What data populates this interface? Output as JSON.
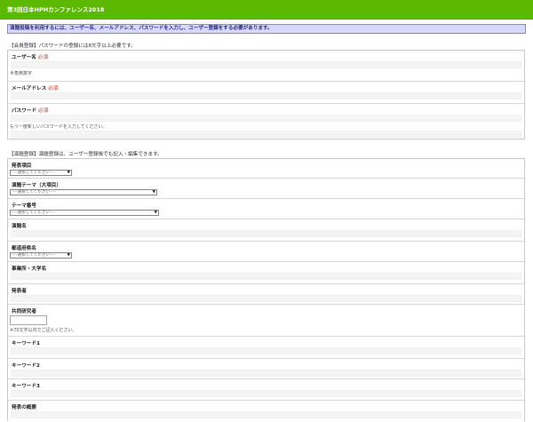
{
  "header": {
    "title": "第3回日本HPHカンファレンス2018"
  },
  "notice": "演題投稿を利用するには、ユーザー名、メールアドレス、パスワードを入力し、ユーザー登録をする必要があります。",
  "member": {
    "section_title": "【会員登録】パスワードの登録には8文字以上必要です。",
    "required": "必須",
    "username_label": "ユーザー名",
    "username_hint": "半角英数字",
    "email_label": "メールアドレス",
    "password_label": "パスワード",
    "password_hint": "もう一度新しいパスワードを入力してください。"
  },
  "abstract": {
    "section_title": "【演題登録】演題登録は、ユーザー登録後でも記入・編集できます。",
    "select_placeholder": "----選択してください----",
    "presentation_type_label": "発表項目",
    "theme_major_label": "演題テーマ（大項目）",
    "theme_number_label": "テーマ番号",
    "title_label": "演題名",
    "prefecture_label": "都道府県名",
    "affiliation_label": "事業所・大学名",
    "presenter_label": "発表者",
    "coauthors_label": "共同研究者",
    "coauthors_hint": "※70文字以内でご記入ください。",
    "keyword1_label": "キーワード1",
    "keyword2_label": "キーワード2",
    "keyword3_label": "キーワード3",
    "summary_label": "発表の概要"
  }
}
